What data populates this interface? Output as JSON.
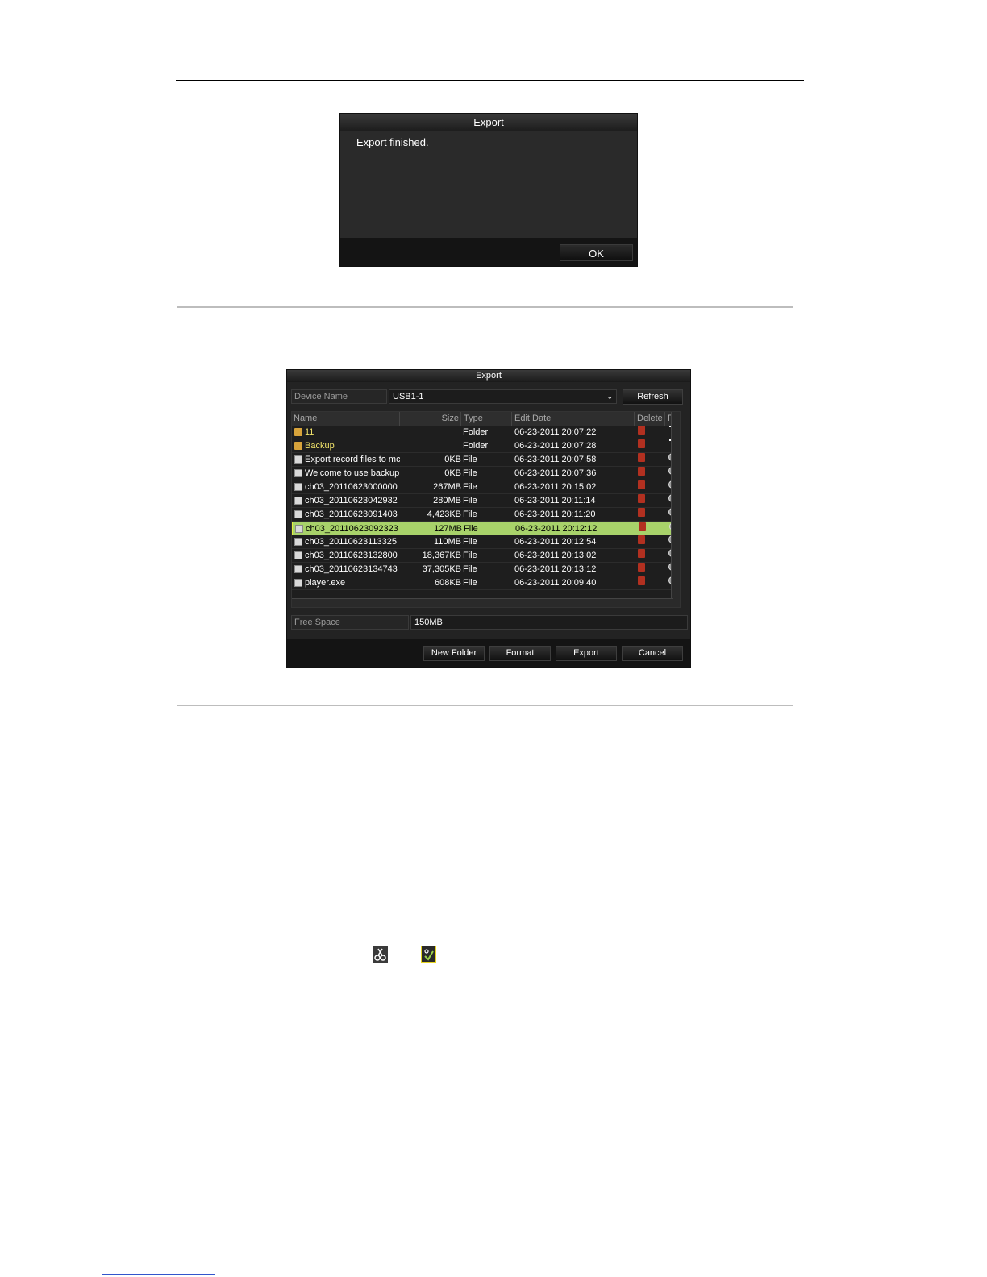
{
  "dialog1": {
    "title": "Export",
    "message": "Export finished.",
    "ok": "OK"
  },
  "dialog2": {
    "title": "Export",
    "device_label": "Device Name",
    "device_value": "USB1-1",
    "refresh": "Refresh",
    "columns": [
      "Name",
      "Size",
      "Type",
      "Edit Date",
      "Delete",
      "Pla"
    ],
    "rows": [
      {
        "name": "11",
        "size": "",
        "type": "Folder",
        "date": "06-23-2011 20:07:22",
        "kind": "folder"
      },
      {
        "name": "Backup",
        "size": "",
        "type": "Folder",
        "date": "06-23-2011 20:07:28",
        "kind": "folder"
      },
      {
        "name": "Export record files to mc",
        "size": "0KB",
        "type": "File",
        "date": "06-23-2011 20:07:58",
        "kind": "file"
      },
      {
        "name": "Welcome to use backup",
        "size": "0KB",
        "type": "File",
        "date": "06-23-2011 20:07:36",
        "kind": "file"
      },
      {
        "name": "ch03_20110623000000",
        "size": "267MB",
        "type": "File",
        "date": "06-23-2011 20:15:02",
        "kind": "file"
      },
      {
        "name": "ch03_20110623042932",
        "size": "280MB",
        "type": "File",
        "date": "06-23-2011 20:11:14",
        "kind": "file"
      },
      {
        "name": "ch03_20110623091403",
        "size": "4,423KB",
        "type": "File",
        "date": "06-23-2011 20:11:20",
        "kind": "file"
      },
      {
        "name": "ch03_20110623092323",
        "size": "127MB",
        "type": "File",
        "date": "06-23-2011 20:12:12",
        "kind": "file",
        "selected": true
      },
      {
        "name": "ch03_20110623113325",
        "size": "110MB",
        "type": "File",
        "date": "06-23-2011 20:12:54",
        "kind": "file"
      },
      {
        "name": "ch03_20110623132800",
        "size": "18,367KB",
        "type": "File",
        "date": "06-23-2011 20:13:02",
        "kind": "file"
      },
      {
        "name": "ch03_20110623134743",
        "size": "37,305KB",
        "type": "File",
        "date": "06-23-2011 20:13:12",
        "kind": "file"
      },
      {
        "name": "player.exe",
        "size": "608KB",
        "type": "File",
        "date": "06-23-2011 20:09:40",
        "kind": "file"
      }
    ],
    "free_label": "Free Space",
    "free_value": "150MB",
    "buttons": [
      "New Folder",
      "Format",
      "Export",
      "Cancel"
    ]
  },
  "icons": [
    "scissors-icon",
    "clip-save-icon"
  ]
}
